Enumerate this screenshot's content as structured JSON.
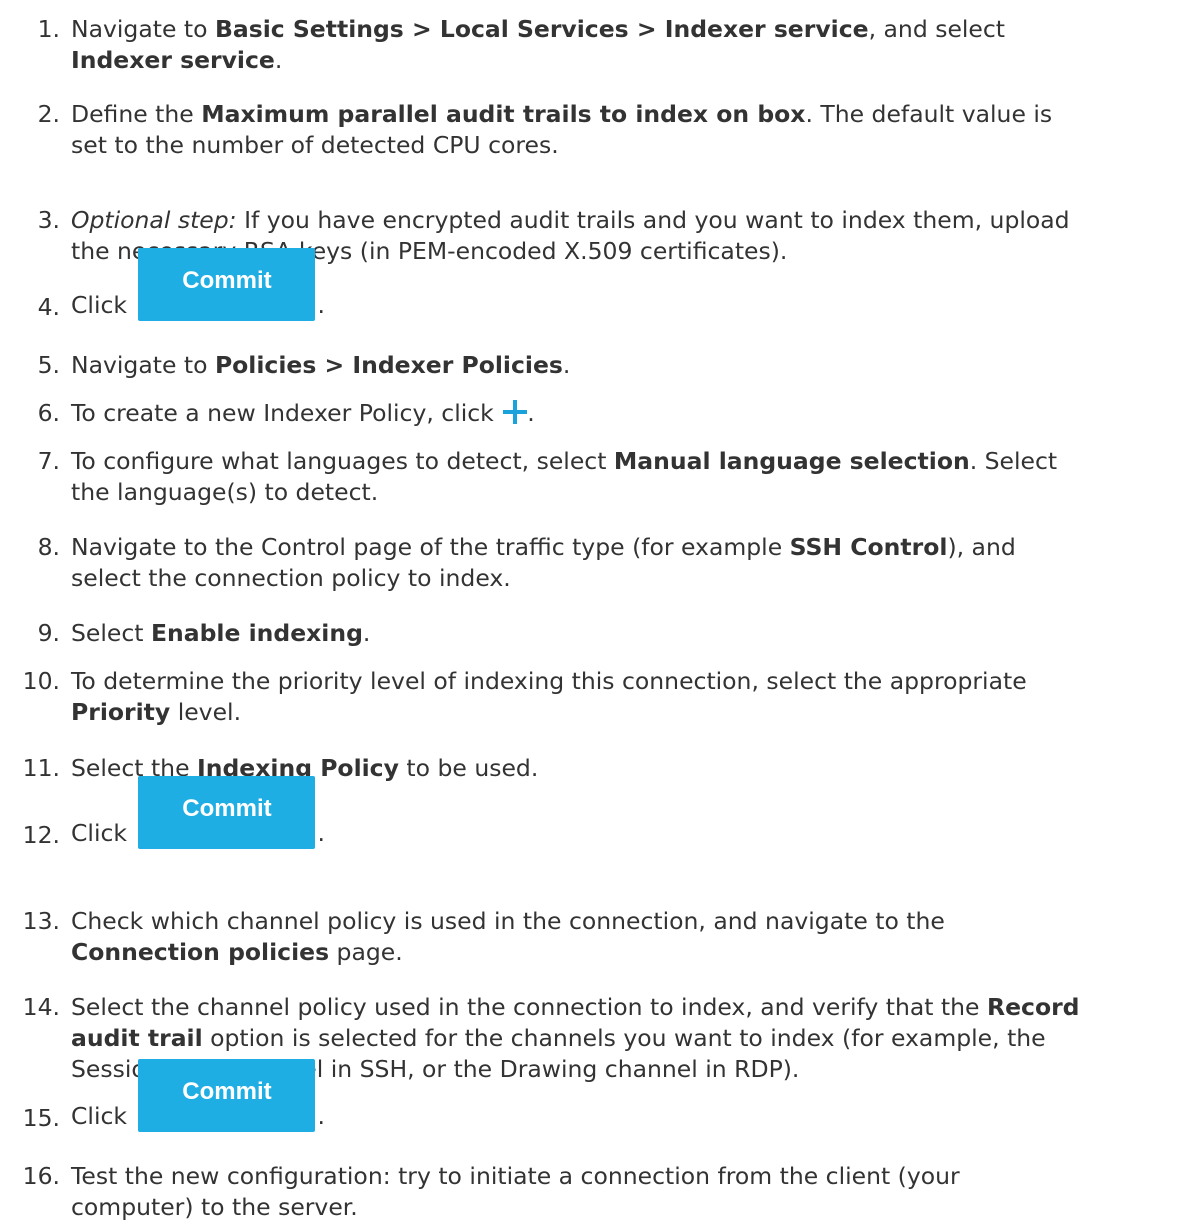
{
  "steps": [
    {
      "num": "1.",
      "lines": [
        [
          "Navigate to ",
          {
            "b": "Basic Settings > Local Services > Indexer service"
          },
          ", and select"
        ],
        [
          {
            "b": "Indexer service"
          },
          "."
        ]
      ]
    },
    {
      "num": "2.",
      "lines": [
        [
          "Define the ",
          {
            "b": "Maximum parallel audit trails to index on box"
          },
          ". The default value is"
        ],
        [
          "set to the number of detected CPU cores."
        ]
      ]
    },
    {
      "num": "3.",
      "lines": [
        [
          {
            "i": "Optional step:"
          },
          " If you have encrypted audit trails and you want to index them, upload"
        ],
        [
          "the necessary RSA keys (in PEM-encoded X.509 certificates)."
        ]
      ]
    },
    {
      "num": "4.",
      "lines": [
        [
          "Click ",
          {
            "button": "commit"
          },
          "."
        ]
      ]
    },
    {
      "num": "5.",
      "lines": [
        [
          "Navigate to ",
          {
            "b": "Policies > Indexer Policies"
          },
          "."
        ]
      ]
    },
    {
      "num": "6.",
      "lines": [
        [
          "To create a new Indexer Policy, click ",
          {
            "icon": "plus-icon"
          },
          "."
        ]
      ]
    },
    {
      "num": "7.",
      "lines": [
        [
          "To configure what languages to detect, select ",
          {
            "b": "Manual language selection"
          },
          ". Select"
        ],
        [
          "the language(s) to detect."
        ]
      ]
    },
    {
      "num": "8.",
      "lines": [
        [
          "Navigate to the Control page of the traffic type (for example ",
          {
            "b": "SSH Control"
          },
          "), and"
        ],
        [
          "select the connection policy to index."
        ]
      ]
    },
    {
      "num": "9.",
      "lines": [
        [
          "Select ",
          {
            "b": "Enable indexing"
          },
          "."
        ]
      ]
    },
    {
      "num": "10.",
      "lines": [
        [
          "To determine the priority level of indexing this connection, select the appropriate"
        ],
        [
          {
            "b": "Priority"
          },
          " level."
        ]
      ]
    },
    {
      "num": "11.",
      "lines": [
        [
          "Select the ",
          {
            "b": "Indexing Policy"
          },
          " to be used."
        ]
      ]
    },
    {
      "num": "12.",
      "lines": [
        [
          "Click ",
          {
            "button": "commit"
          },
          "."
        ]
      ]
    },
    {
      "num": "13.",
      "lines": [
        [
          "Check which channel policy is used in the connection, and navigate to the"
        ],
        [
          {
            "b": "Connection policies"
          },
          " page."
        ]
      ]
    },
    {
      "num": "14.",
      "lines": [
        [
          "Select the channel policy used in the connection to index, and verify that the ",
          {
            "b": "Record"
          }
        ],
        [
          {
            "b": "audit trail"
          },
          " option is selected for the channels you want to index (for example, the"
        ],
        [
          "Session shell channel in SSH, or the Drawing channel in RDP)."
        ]
      ]
    },
    {
      "num": "15.",
      "lines": [
        [
          "Click ",
          {
            "button": "commit"
          },
          "."
        ]
      ]
    },
    {
      "num": "16.",
      "lines": [
        [
          "Test the new configuration: try to initiate a connection from the client (your"
        ],
        [
          "computer) to the server."
        ]
      ]
    }
  ],
  "buttons": {
    "commit": "Commit"
  },
  "colors": {
    "text": "#333333",
    "accent": "#1eaee4",
    "button_text": "#ffffff"
  }
}
